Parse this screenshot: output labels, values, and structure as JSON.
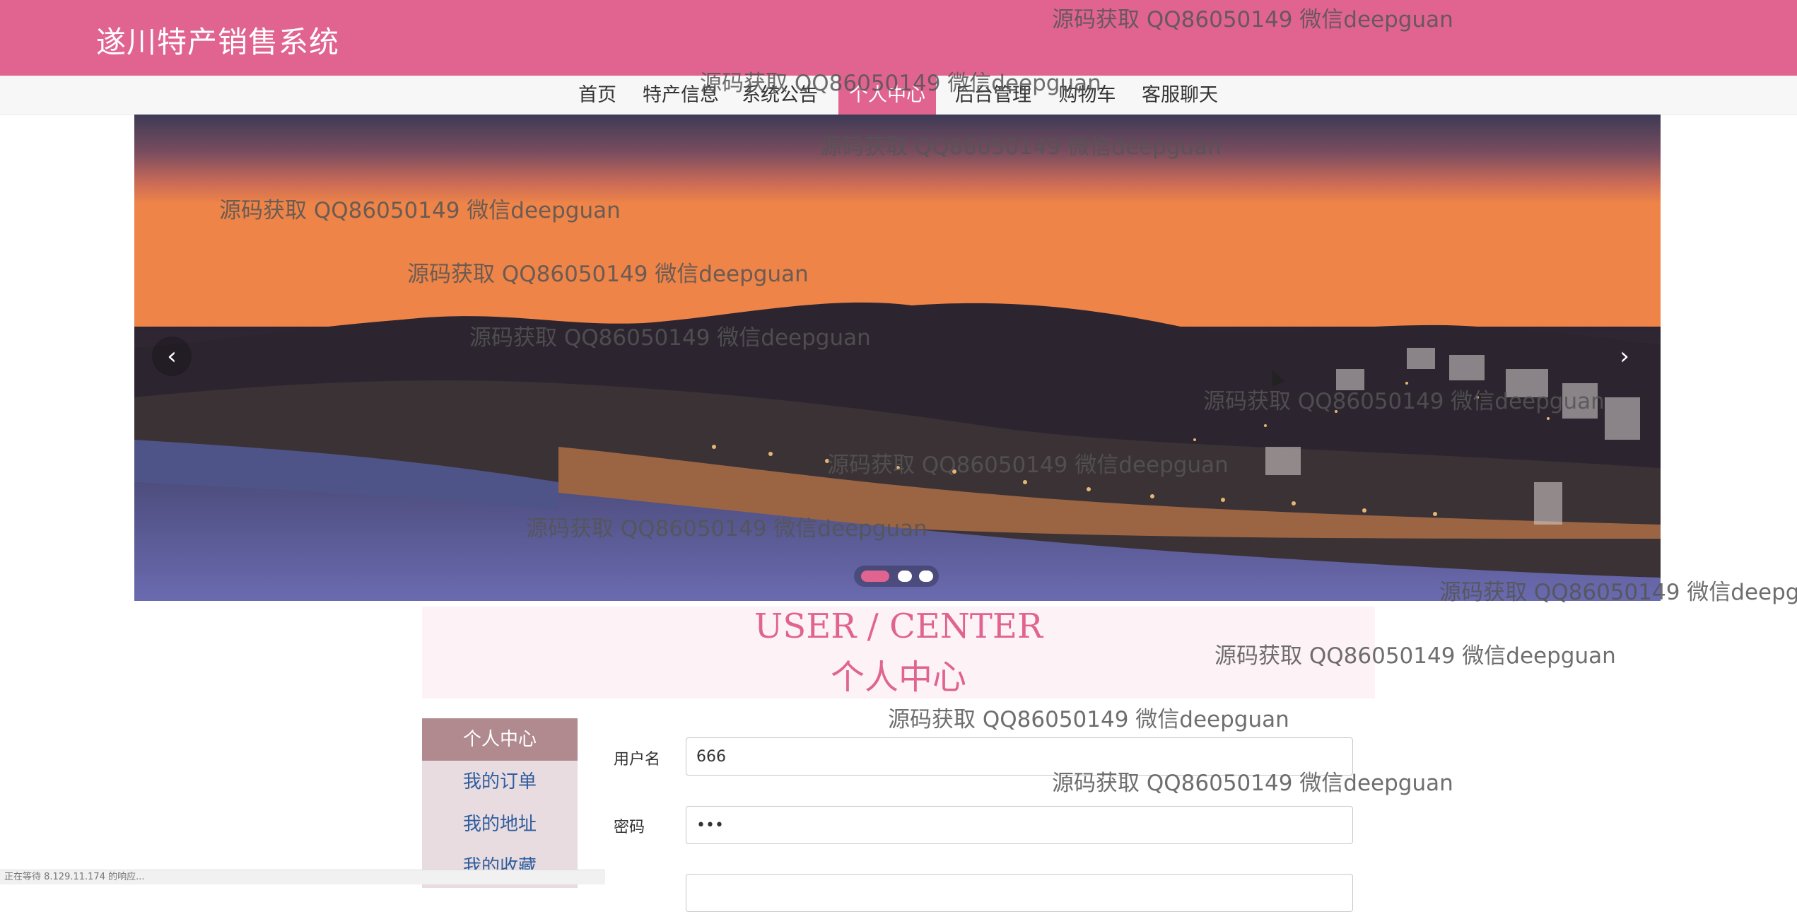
{
  "header": {
    "title": "遂川特产销售系统"
  },
  "nav": {
    "items": [
      {
        "label": "首页"
      },
      {
        "label": "特产信息"
      },
      {
        "label": "系统公告"
      },
      {
        "label": "个人中心"
      },
      {
        "label": "后台管理"
      },
      {
        "label": "购物车"
      },
      {
        "label": "客服聊天"
      }
    ],
    "active": "个人中心",
    "accent_color": "#e0648f"
  },
  "carousel": {
    "prev_icon": "chevron-left-icon",
    "next_icon": "chevron-right-icon",
    "slide_count": 3,
    "active_index": 0
  },
  "center": {
    "title_en": "USER / CENTER",
    "title_cn": "个人中心"
  },
  "side_menu": {
    "items": [
      {
        "label": "个人中心"
      },
      {
        "label": "我的订单"
      },
      {
        "label": "我的地址"
      },
      {
        "label": "我的收藏"
      }
    ],
    "active": "个人中心"
  },
  "form": {
    "username_label": "用户名",
    "username_value": "666",
    "password_label": "密码",
    "password_value": "•••"
  },
  "watermark": {
    "text": "源码获取 QQ86050149 微信deepguan"
  },
  "status": {
    "text": "正在等待 8.129.11.174 的响应..."
  }
}
